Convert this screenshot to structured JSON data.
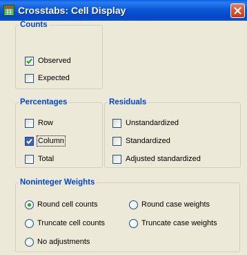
{
  "window": {
    "title": "Crosstabs: Cell Display",
    "app_icon": "spss-table-icon",
    "close_icon": "close-icon"
  },
  "counts": {
    "legend": "Counts",
    "options": [
      {
        "label": "Observed",
        "checked": true
      },
      {
        "label": "Expected",
        "checked": false
      }
    ]
  },
  "percentages": {
    "legend": "Percentages",
    "options": [
      {
        "label": "Row",
        "checked": false
      },
      {
        "label": "Column",
        "checked": true,
        "focused": true
      },
      {
        "label": "Total",
        "checked": false
      }
    ]
  },
  "residuals": {
    "legend": "Residuals",
    "options": [
      {
        "label": "Unstandardized",
        "checked": false
      },
      {
        "label": "Standardized",
        "checked": false
      },
      {
        "label": "Adjusted standardized",
        "checked": false
      }
    ]
  },
  "weights": {
    "legend": "Noninteger Weights",
    "options": [
      {
        "label": "Round cell counts",
        "selected": true
      },
      {
        "label": "Round case weights",
        "selected": false
      },
      {
        "label": "Truncate cell counts",
        "selected": false
      },
      {
        "label": "Truncate case weights",
        "selected": false
      },
      {
        "label": "No adjustments",
        "selected": false
      }
    ]
  },
  "colors": {
    "title_bar": "#0b58d8",
    "group_title": "#0046d5",
    "dialog_bg": "#ece9d8",
    "check": "#21a121"
  }
}
